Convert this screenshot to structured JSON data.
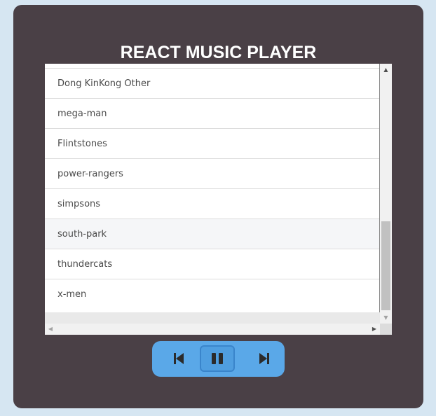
{
  "app": {
    "title": "REACT MUSIC PLAYER"
  },
  "playlist": {
    "tracks": [
      {
        "label": "Dong KinKong Other"
      },
      {
        "label": "mega-man"
      },
      {
        "label": "Flintstones"
      },
      {
        "label": "power-rangers"
      },
      {
        "label": "simpsons"
      },
      {
        "label": "south-park"
      },
      {
        "label": "thundercats"
      },
      {
        "label": "x-men"
      }
    ],
    "active_track": "south-park"
  },
  "controls": {
    "prev_icon": "skip-previous-icon",
    "pause_icon": "pause-icon",
    "next_icon": "skip-next-icon"
  },
  "colors": {
    "page_background": "#d6e6f2",
    "player_background": "#4a4046",
    "controls_background": "#5aa8e8",
    "title_text": "#ffffff"
  }
}
